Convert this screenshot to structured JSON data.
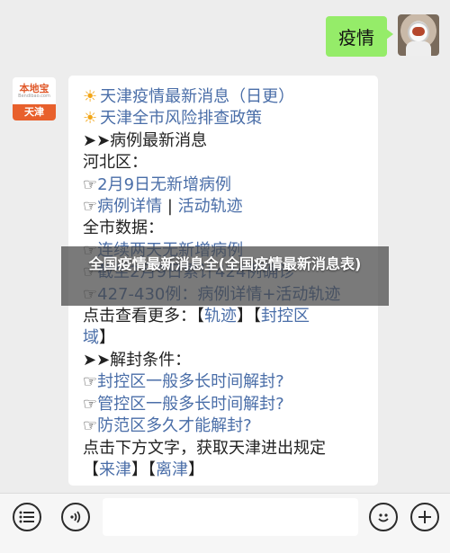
{
  "user_message": {
    "text": "疫情"
  },
  "bot": {
    "avatar_brand": "本地宝",
    "avatar_sub": "Bendibao.com",
    "avatar_city": "天津",
    "lines": [
      {
        "segments": [
          {
            "t": "☀",
            "c": "sun"
          },
          {
            "t": "天津疫情最新消息（日更）",
            "c": "link"
          }
        ]
      },
      {
        "segments": [
          {
            "t": "☀",
            "c": "sun"
          },
          {
            "t": "天津全市风险排查政策",
            "c": "link"
          }
        ]
      },
      {
        "segments": [
          {
            "t": "➤➤病例最新消息",
            "c": ""
          }
        ]
      },
      {
        "segments": [
          {
            "t": "河北区：",
            "c": ""
          }
        ]
      },
      {
        "segments": [
          {
            "t": "☞",
            "c": ""
          },
          {
            "t": "2月9日无新增病例",
            "c": "link"
          }
        ]
      },
      {
        "segments": [
          {
            "t": "☞",
            "c": ""
          },
          {
            "t": "病例详情",
            "c": "link"
          },
          {
            "t": " | ",
            "c": ""
          },
          {
            "t": "活动轨迹",
            "c": "link"
          }
        ]
      },
      {
        "segments": [
          {
            "t": "全市数据：",
            "c": ""
          }
        ]
      },
      {
        "segments": [
          {
            "t": "☞",
            "c": ""
          },
          {
            "t": "连续两天无新增病例",
            "c": "link"
          }
        ]
      },
      {
        "segments": [
          {
            "t": "☞",
            "c": ""
          },
          {
            "t": "截至2月9日累计424例确诊",
            "c": "link"
          }
        ]
      },
      {
        "segments": [
          {
            "t": "☞",
            "c": ""
          },
          {
            "t": "427-430例：病例详情+活动轨迹",
            "c": "link"
          }
        ]
      },
      {
        "segments": [
          {
            "t": "点击查看更多：【",
            "c": ""
          },
          {
            "t": "轨迹",
            "c": "link"
          },
          {
            "t": "】【",
            "c": ""
          },
          {
            "t": "封控区",
            "c": "link"
          }
        ]
      },
      {
        "segments": [
          {
            "t": "域",
            "c": "link"
          },
          {
            "t": "】",
            "c": ""
          }
        ]
      },
      {
        "segments": [
          {
            "t": "➤➤解封条件：",
            "c": ""
          }
        ]
      },
      {
        "segments": [
          {
            "t": "☞",
            "c": ""
          },
          {
            "t": "封控区一般多长时间解封?",
            "c": "link"
          }
        ]
      },
      {
        "segments": [
          {
            "t": "☞",
            "c": ""
          },
          {
            "t": "管控区一般多长时间解封?",
            "c": "link"
          }
        ]
      },
      {
        "segments": [
          {
            "t": "☞",
            "c": ""
          },
          {
            "t": "防范区多久才能解封?",
            "c": "link"
          }
        ]
      },
      {
        "segments": [
          {
            "t": "点击下方文字，获取天津进出规定",
            "c": ""
          }
        ]
      },
      {
        "segments": [
          {
            "t": "【",
            "c": ""
          },
          {
            "t": "来津",
            "c": "link"
          },
          {
            "t": "】【",
            "c": ""
          },
          {
            "t": "离津",
            "c": "link"
          },
          {
            "t": "】",
            "c": ""
          }
        ]
      }
    ]
  },
  "banner": {
    "text": "全国疫情最新消息全(全国疫情最新消息表)"
  },
  "bottom_bar": {
    "icons": [
      "menu-list-icon",
      "voice-icon",
      "emoji-icon",
      "plus-icon"
    ],
    "input_value": ""
  }
}
